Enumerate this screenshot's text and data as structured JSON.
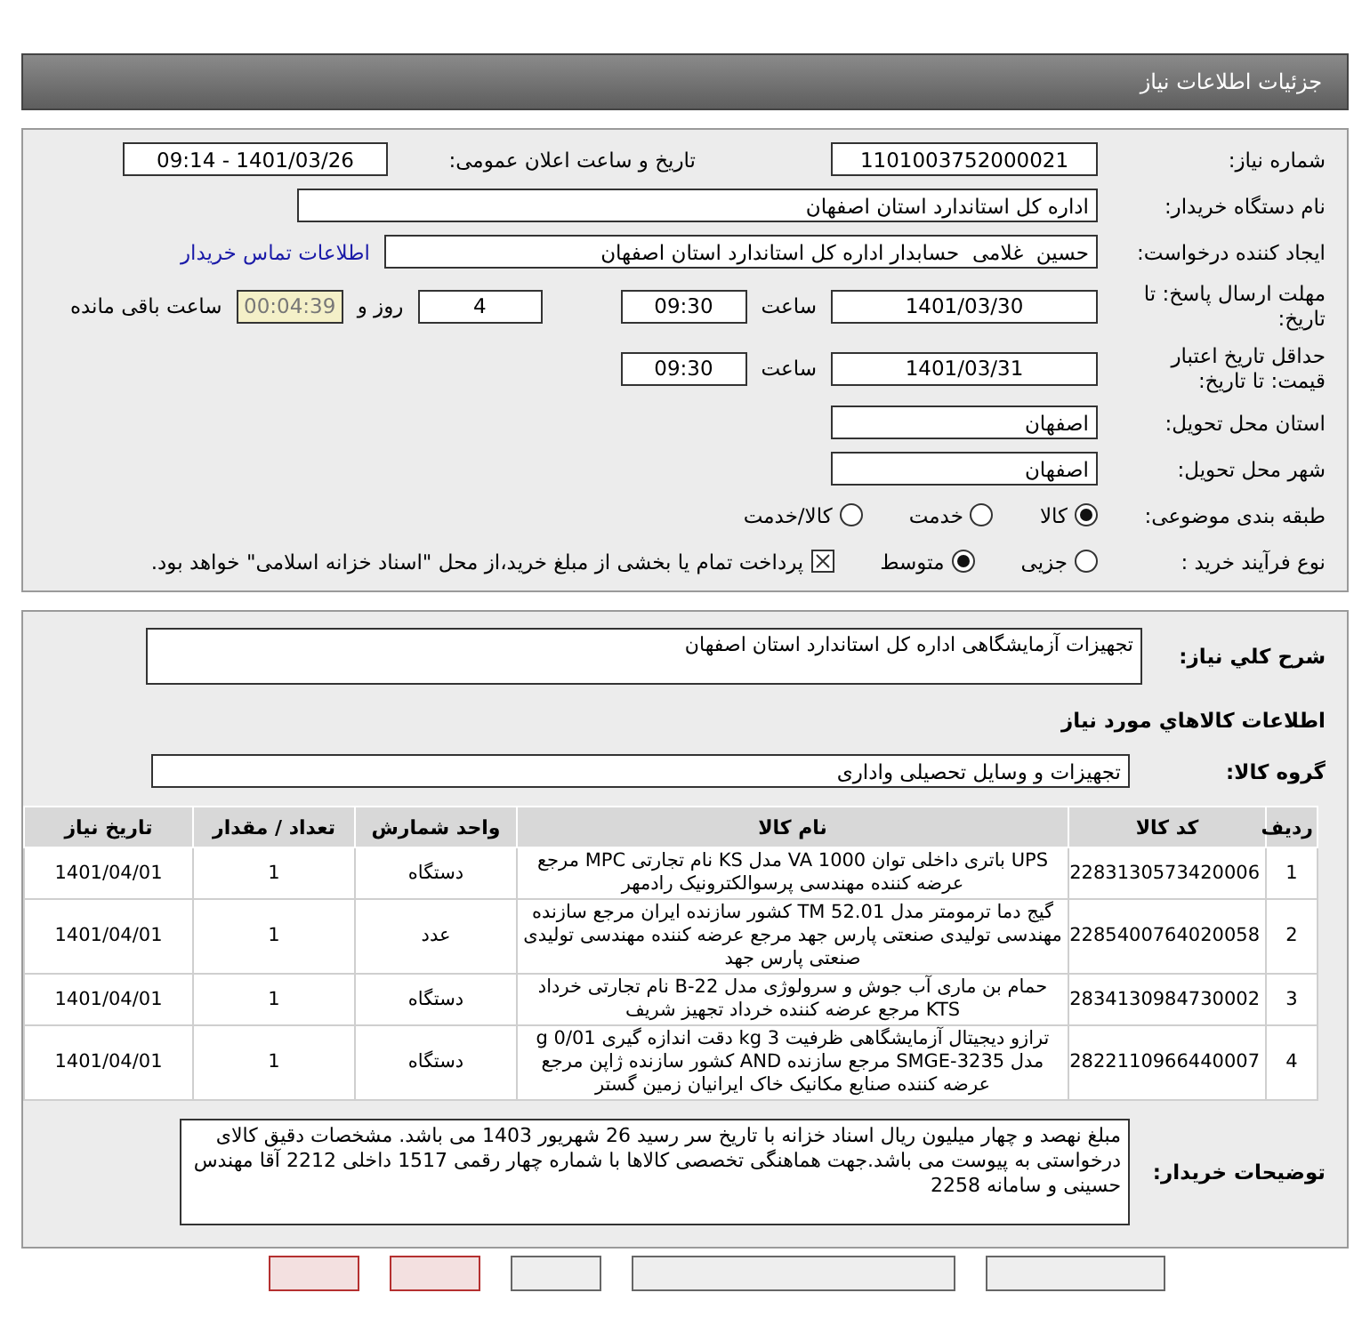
{
  "header": {
    "title": "جزئیات اطلاعات نیاز"
  },
  "need_number": {
    "label": "شماره نیاز:",
    "value": "1101003752000021"
  },
  "announce": {
    "label": "تاریخ و ساعت اعلان عمومی:",
    "value": "1401/03/26 - 09:14"
  },
  "buyer_org": {
    "label": "نام دستگاه خریدار:",
    "value": "اداره کل استاندارد استان اصفهان"
  },
  "requester": {
    "label": "ایجاد کننده درخواست:",
    "value": "حسین  غلامی  حسابدار اداره کل استاندارد استان اصفهان",
    "link": "اطلاعات تماس خریدار"
  },
  "reply_deadline": {
    "label": "مهلت ارسال پاسخ: تا تاریخ:",
    "date": "1401/03/30",
    "time_label": "ساعت",
    "time": "09:30",
    "days": "4",
    "days_label": "روز و",
    "remaining": "00:04:39",
    "remaining_label": "ساعت باقی مانده"
  },
  "price_validity": {
    "label": "حداقل تاریخ اعتبار قیمت: تا تاریخ:",
    "date": "1401/03/31",
    "time_label": "ساعت",
    "time": "09:30"
  },
  "delivery_province": {
    "label": "استان محل تحویل:",
    "value": "اصفهان"
  },
  "delivery_city": {
    "label": "شهر محل تحویل:",
    "value": "اصفهان"
  },
  "category": {
    "label": "طبقه بندی موضوعی:",
    "options": [
      {
        "label": "کالا",
        "selected": true
      },
      {
        "label": "خدمت",
        "selected": false
      },
      {
        "label": "کالا/خدمت",
        "selected": false
      }
    ]
  },
  "purchase_type": {
    "label": "نوع فرآیند خرید :",
    "options": [
      {
        "label": "جزیی",
        "selected": false
      },
      {
        "label": "متوسط",
        "selected": true
      }
    ],
    "treasury": {
      "label": "پرداخت تمام یا بخشی از مبلغ خرید،از محل \"اسناد خزانه اسلامی\" خواهد بود.",
      "checked": true
    }
  },
  "summary": {
    "label": "شرح کلي نياز:",
    "value": "تجهیزات آزمایشگاهی اداره کل استاندارد استان اصفهان"
  },
  "goods_title": "اطلاعات کالاهاي مورد نياز",
  "goods_group": {
    "label": "گروه کالا:",
    "value": "تجهیزات و وسایل تحصیلی واداری"
  },
  "table": {
    "columns": [
      "ردیف",
      "کد کالا",
      "نام کالا",
      "واحد شمارش",
      "تعداد / مقدار",
      "تاریخ نیاز"
    ],
    "rows": [
      [
        "1",
        "2283130573420006",
        "UPS باتری داخلی توان 1000 VA مدل KS نام تجارتی MPC مرجع عرضه کننده مهندسی پرسوالکترونیک رادمهر",
        "دستگاه",
        "1",
        "1401/04/01"
      ],
      [
        "2",
        "2285400764020058",
        "گیج دما ترمومتر مدل TM 52.01 کشور سازنده ایران مرجع سازنده مهندسی تولیدی صنعتی پارس جهد مرجع عرضه کننده مهندسی تولیدی صنعتی پارس جهد",
        "عدد",
        "1",
        "1401/04/01"
      ],
      [
        "3",
        "2834130984730002",
        "حمام بن ماری آب جوش و سرولوژی مدل B-22 نام تجارتی خرداد KTS مرجع عرضه کننده خرداد تجهیز شریف",
        "دستگاه",
        "1",
        "1401/04/01"
      ],
      [
        "4",
        "2822110966440007",
        "ترازو دیجیتال آزمایشگاهی ظرفیت 3 kg دقت اندازه گیری 0/01 g مدل SMGE-3235 مرجع سازنده AND کشور سازنده ژاپن مرجع عرضه کننده صنایع مکانیک خاک ایرانیان زمین گستر",
        "دستگاه",
        "1",
        "1401/04/01"
      ]
    ]
  },
  "buyer_notes": {
    "label": "توضیحات خریدار:",
    "value": "مبلغ نهصد و چهار میلیون ریال اسناد خزانه با تاریخ سر رسید 26 شهریور 1403 می باشد. مشخصات دقیق کالای درخواستی به پیوست می باشد.جهت هماهنگی تخصصی کالاها با شماره چهار رقمی 1517 داخلی 2212 آقا مهندس حسینی و سامانه 2258"
  },
  "bottom_buttons": [
    {
      "kind": "plain"
    },
    {
      "kind": "plain"
    },
    {
      "kind": "plain"
    },
    {
      "kind": "red"
    },
    {
      "kind": "red"
    }
  ]
}
